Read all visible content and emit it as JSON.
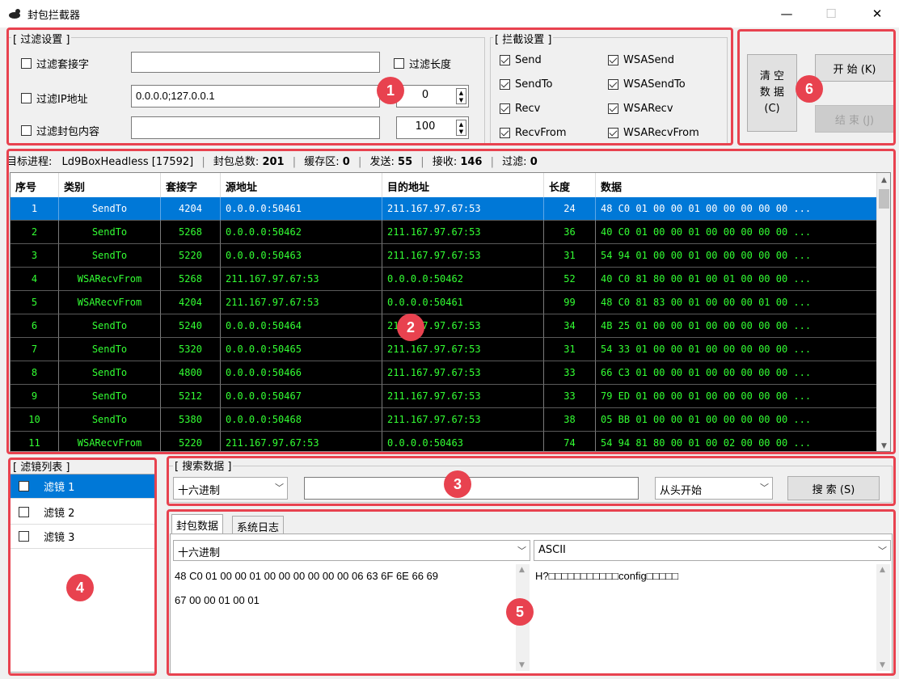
{
  "window": {
    "title": "封包拦截器",
    "min_label": "—",
    "max_label": "☐",
    "close_label": "✕"
  },
  "filter_settings": {
    "label": "[ 过滤设置 ]",
    "socket_label": "过滤套接字",
    "socket_value": "",
    "ip_label": "过滤IP地址",
    "ip_value": "0.0.0.0;127.0.0.1",
    "content_label": "过滤封包内容",
    "content_value": "",
    "length_label": "过滤长度",
    "length_min": "0",
    "length_max": "100"
  },
  "intercept_settings": {
    "label": "[ 拦截设置 ]",
    "items": [
      {
        "label": "Send",
        "checked": true
      },
      {
        "label": "SendTo",
        "checked": true
      },
      {
        "label": "Recv",
        "checked": true
      },
      {
        "label": "RecvFrom",
        "checked": true
      },
      {
        "label": "WSASend",
        "checked": true
      },
      {
        "label": "WSASendTo",
        "checked": true
      },
      {
        "label": "WSARecv",
        "checked": true
      },
      {
        "label": "WSARecvFrom",
        "checked": true
      }
    ]
  },
  "buttons": {
    "clear": "清 空\n数 据\n(C)",
    "start": "开 始 (K)",
    "stop": "结 束 (J)",
    "search": "搜 索 (S)"
  },
  "status": {
    "target_label": "目标进程:",
    "target_value": "Ld9BoxHeadless [17592]",
    "total_label": "封包总数:",
    "total_value": "201",
    "buffer_label": "缓存区:",
    "buffer_value": "0",
    "send_label": "发送:",
    "send_value": "55",
    "recv_label": "接收:",
    "recv_value": "146",
    "filter_label": "过滤:",
    "filter_value": "0"
  },
  "table": {
    "columns": [
      "序号",
      "类别",
      "套接字",
      "源地址",
      "目的地址",
      "长度",
      "数据"
    ],
    "rows": [
      [
        "1",
        "SendTo",
        "4204",
        "0.0.0.0:50461",
        "211.167.97.67:53",
        "24",
        "48 C0 01 00 00 01 00 00 00 00 00 ..."
      ],
      [
        "2",
        "SendTo",
        "5268",
        "0.0.0.0:50462",
        "211.167.97.67:53",
        "36",
        "40 C0 01 00 00 01 00 00 00 00 00 ..."
      ],
      [
        "3",
        "SendTo",
        "5220",
        "0.0.0.0:50463",
        "211.167.97.67:53",
        "31",
        "54 94 01 00 00 01 00 00 00 00 00 ..."
      ],
      [
        "4",
        "WSARecvFrom",
        "5268",
        "211.167.97.67:53",
        "0.0.0.0:50462",
        "52",
        "40 C0 81 80 00 01 00 01 00 00 00 ..."
      ],
      [
        "5",
        "WSARecvFrom",
        "4204",
        "211.167.97.67:53",
        "0.0.0.0:50461",
        "99",
        "48 C0 81 83 00 01 00 00 00 01 00 ..."
      ],
      [
        "6",
        "SendTo",
        "5240",
        "0.0.0.0:50464",
        "211.167.97.67:53",
        "34",
        "4B 25 01 00 00 01 00 00 00 00 00 ..."
      ],
      [
        "7",
        "SendTo",
        "5320",
        "0.0.0.0:50465",
        "211.167.97.67:53",
        "31",
        "54 33 01 00 00 01 00 00 00 00 00 ..."
      ],
      [
        "8",
        "SendTo",
        "4800",
        "0.0.0.0:50466",
        "211.167.97.67:53",
        "33",
        "66 C3 01 00 00 01 00 00 00 00 00 ..."
      ],
      [
        "9",
        "SendTo",
        "5212",
        "0.0.0.0:50467",
        "211.167.97.67:53",
        "33",
        "79 ED 01 00 00 01 00 00 00 00 00 ..."
      ],
      [
        "10",
        "SendTo",
        "5380",
        "0.0.0.0:50468",
        "211.167.97.67:53",
        "38",
        "05 BB 01 00 00 01 00 00 00 00 00 ..."
      ],
      [
        "11",
        "WSARecvFrom",
        "5220",
        "211.167.97.67:53",
        "0.0.0.0:50463",
        "74",
        "54 94 81 80 00 01 00 02 00 00 00 ..."
      ]
    ]
  },
  "filter_list": {
    "label": "[ 滤镜列表 ]",
    "items": [
      "滤镜 1",
      "滤镜 2",
      "滤镜 3"
    ]
  },
  "search": {
    "label": "[ 搜索数据 ]",
    "mode": "十六进制",
    "query": "",
    "origin": "从头开始"
  },
  "tabs": [
    "封包数据",
    "系统日志"
  ],
  "packet_view": {
    "left_format": "十六进制",
    "right_format": "ASCII",
    "hex_text": "48 C0 01 00 00 01 00 00 00 00 00 00 06 63 6F 6E 66 69\n67 00 00 01 00 01",
    "ascii_text": "H?□□□□□□□□□□□config□□□□□"
  },
  "badges": [
    "1",
    "2",
    "3",
    "4",
    "5",
    "6"
  ],
  "colors": {
    "highlight": "#e8424f",
    "selection": "#0078d7",
    "grid_bg": "#000000",
    "grid_text": "#33ff33"
  }
}
